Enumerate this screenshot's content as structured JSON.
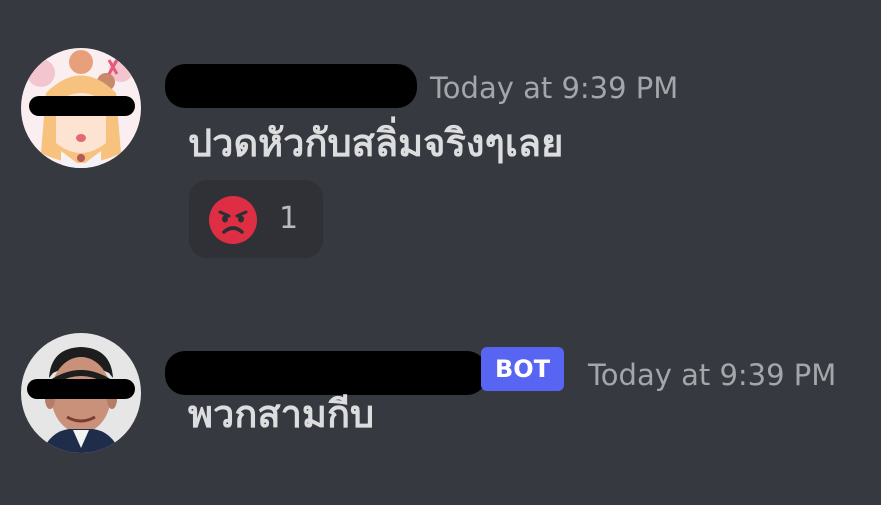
{
  "colors": {
    "background": "#36393f",
    "text": "#dcddde",
    "timestamp": "#a3a6aa",
    "bot_tag": "#5865f2",
    "reaction_bg": "#2f3136"
  },
  "messages": [
    {
      "username": "",
      "timestamp": "Today at 9:39 PM",
      "content": "ปวดหัวกับสลิ่มจริงๆเลย",
      "avatar_icon": "anime-girl-avatar-icon",
      "reactions": [
        {
          "emoji": "angry-face-icon",
          "count": "1"
        }
      ]
    },
    {
      "username": "",
      "bot_tag": "BOT",
      "timestamp": "Today at 9:39 PM",
      "content": "พวกสามกีบ",
      "avatar_icon": "man-portrait-avatar-icon"
    }
  ]
}
